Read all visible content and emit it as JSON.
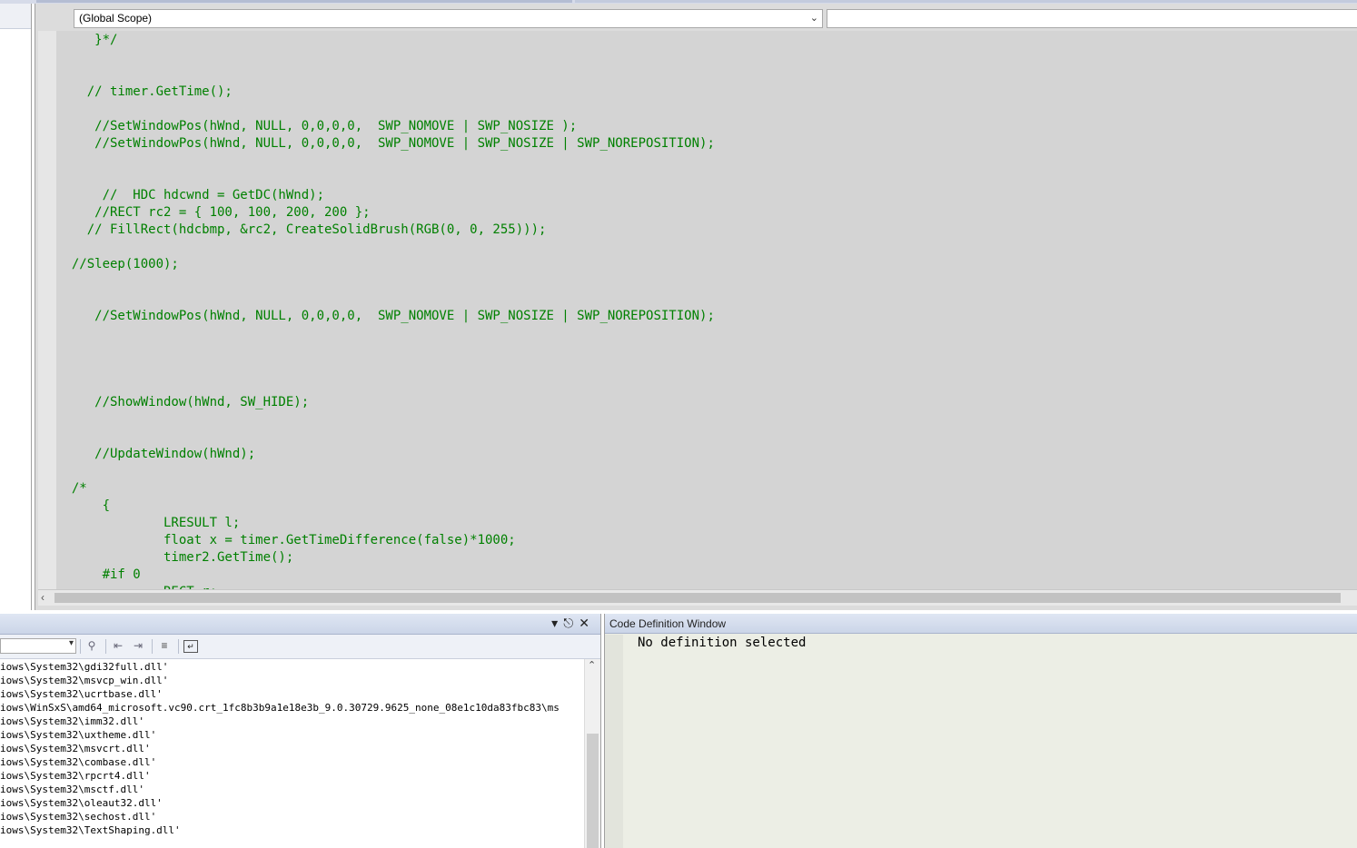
{
  "navigation": {
    "scope": "(Global Scope)",
    "member": ""
  },
  "code_lines": [
    {
      "row": 0,
      "text": "     }*/"
    },
    {
      "row": 3,
      "text": "    // timer.GetTime();"
    },
    {
      "row": 5,
      "text": "     //SetWindowPos(hWnd, NULL, 0,0,0,0,  SWP_NOMOVE | SWP_NOSIZE );"
    },
    {
      "row": 6,
      "text": "     //SetWindowPos(hWnd, NULL, 0,0,0,0,  SWP_NOMOVE | SWP_NOSIZE | SWP_NOREPOSITION);"
    },
    {
      "row": 9,
      "text": "      //  HDC hdcwnd = GetDC(hWnd);"
    },
    {
      "row": 10,
      "text": "     //RECT rc2 = { 100, 100, 200, 200 };"
    },
    {
      "row": 11,
      "text": "    // FillRect(hdcbmp, &rc2, CreateSolidBrush(RGB(0, 0, 255)));"
    },
    {
      "row": 13,
      "text": "  //Sleep(1000);"
    },
    {
      "row": 16,
      "text": "     //SetWindowPos(hWnd, NULL, 0,0,0,0,  SWP_NOMOVE | SWP_NOSIZE | SWP_NOREPOSITION);"
    },
    {
      "row": 21,
      "text": "     //ShowWindow(hWnd, SW_HIDE);"
    },
    {
      "row": 24,
      "text": "     //UpdateWindow(hWnd);"
    },
    {
      "row": 26,
      "text": "  /*"
    },
    {
      "row": 27,
      "text": "      {"
    },
    {
      "row": 28,
      "text": "              LRESULT l;"
    },
    {
      "row": 29,
      "text": "              float x = timer.GetTimeDifference(false)*1000;"
    },
    {
      "row": 30,
      "text": "              timer2.GetTime();"
    },
    {
      "row": 31,
      "text": "      #if 0"
    },
    {
      "row": 32,
      "text": "              RECT r;"
    }
  ],
  "output": {
    "lines": [
      "iows\\System32\\gdi32full.dll'",
      "iows\\System32\\msvcp_win.dll'",
      "iows\\System32\\ucrtbase.dll'",
      "iows\\WinSxS\\amd64_microsoft.vc90.crt_1fc8b3b9a1e18e3b_9.0.30729.9625_none_08e1c10da83fbc83\\ms",
      "iows\\System32\\imm32.dll'",
      "iows\\System32\\uxtheme.dll'",
      "iows\\System32\\msvcrt.dll'",
      "iows\\System32\\combase.dll'",
      "iows\\System32\\rpcrt4.dll'",
      "iows\\System32\\msctf.dll'",
      "iows\\System32\\oleaut32.dll'",
      "iows\\System32\\sechost.dll'",
      "iows\\System32\\TextShaping.dll'"
    ],
    "source": ""
  },
  "code_definition": {
    "title": "Code Definition Window",
    "text": "No definition selected"
  },
  "colors": {
    "comment": "#008000",
    "editor_bg": "#d4d4d4",
    "panel_title": "#cbd5e8"
  },
  "icons": {
    "dropdown": "chevron-down-icon",
    "pin": "pin-icon",
    "close": "close-icon"
  }
}
